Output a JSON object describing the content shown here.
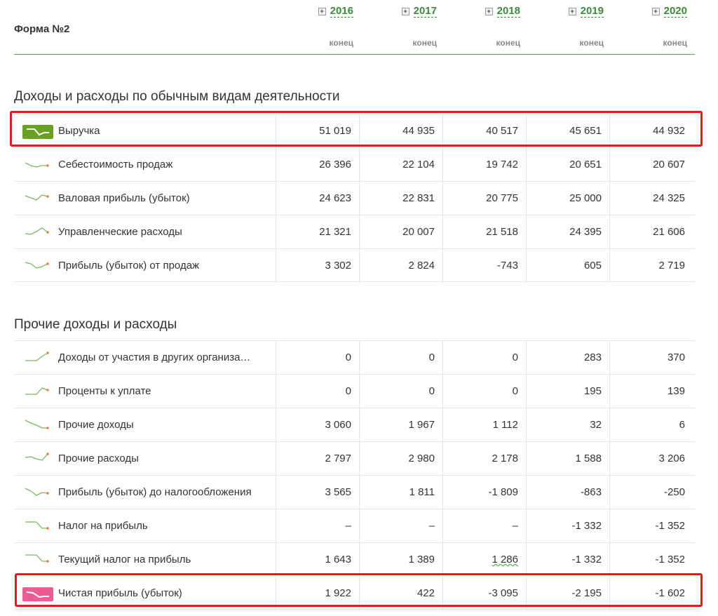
{
  "form_title": "Форма №2",
  "columns": [
    {
      "year": "2016",
      "sub": "конец"
    },
    {
      "year": "2017",
      "sub": "конец"
    },
    {
      "year": "2018",
      "sub": "конец"
    },
    {
      "year": "2019",
      "sub": "конец"
    },
    {
      "year": "2020",
      "sub": "конец"
    }
  ],
  "sections": [
    {
      "title": "Доходы и расходы по обычным видам деятельности",
      "rows": [
        {
          "label": "Выручка",
          "values": [
            "51 019",
            "44 935",
            "40 517",
            "45 651",
            "44 932"
          ],
          "spark": "box",
          "spark_color": "#6aa121",
          "highlighted": true
        },
        {
          "label": "Себестоимость продаж",
          "values": [
            "26 396",
            "22 104",
            "19 742",
            "20 651",
            "20 607"
          ],
          "spark": "line"
        },
        {
          "label": "Валовая прибыль (убыток)",
          "values": [
            "24 623",
            "22 831",
            "20 775",
            "25 000",
            "24 325"
          ],
          "spark": "line"
        },
        {
          "label": "Управленческие расходы",
          "values": [
            "21 321",
            "20 007",
            "21 518",
            "24 395",
            "21 606"
          ],
          "spark": "line"
        },
        {
          "label": "Прибыль (убыток) от продаж",
          "values": [
            "3 302",
            "2 824",
            "-743",
            "605",
            "2 719"
          ],
          "spark": "line"
        }
      ]
    },
    {
      "title": "Прочие доходы и расходы",
      "rows": [
        {
          "label": "Доходы от участия в других организа…",
          "values": [
            "0",
            "0",
            "0",
            "283",
            "370"
          ],
          "spark": "line"
        },
        {
          "label": "Проценты к уплате",
          "values": [
            "0",
            "0",
            "0",
            "195",
            "139"
          ],
          "spark": "line"
        },
        {
          "label": "Прочие доходы",
          "values": [
            "3 060",
            "1 967",
            "1 112",
            "32",
            "6"
          ],
          "spark": "line"
        },
        {
          "label": "Прочие расходы",
          "values": [
            "2 797",
            "2 980",
            "2 178",
            "1 588",
            "3 206"
          ],
          "spark": "line"
        },
        {
          "label": "Прибыль (убыток) до налогообложения",
          "values": [
            "3 565",
            "1 811",
            "-1 809",
            "-863",
            "-250"
          ],
          "spark": "line"
        },
        {
          "label": "Налог на прибыль",
          "values": [
            "–",
            "–",
            "–",
            "-1 332",
            "-1 352"
          ],
          "spark": "line"
        },
        {
          "label": "Текущий налог на прибыль",
          "values": [
            "1 643",
            "1 389",
            "1 286",
            "-1 332",
            "-1 352"
          ],
          "spark": "line",
          "flagged_cell": 2
        },
        {
          "label": "Чистая прибыль (убыток)",
          "values": [
            "1 922",
            "422",
            "-3 095",
            "-2 195",
            "-1 602"
          ],
          "spark": "box",
          "spark_color": "#ec5b92",
          "highlighted": true
        }
      ]
    }
  ],
  "colors": {
    "accent_green": "#3c8a3c",
    "spark_line": "#7bb661",
    "spark_dot": "#f07f3c",
    "highlight_border": "#e21a1a"
  }
}
